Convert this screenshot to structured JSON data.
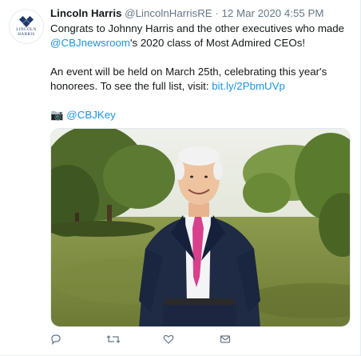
{
  "tweet": {
    "author_name": "Lincoln Harris",
    "author_handle": "@LincolnHarrisRE",
    "separator": "·",
    "timestamp": "12 Mar 2020 4:55 PM",
    "avatar_text_line1": "LINCOLN",
    "avatar_text_line2": "HARRIS",
    "paragraph1_part1": "Congrats to Johnny Harris and the other executives who made ",
    "mention_cbjnewsroom": "@CBJnewsroom",
    "paragraph1_part2": "'s 2020 class of Most Admired CEOs!",
    "paragraph2_part1": "An event will be held on March 25th, celebrating this year's honorees. To see the full list, visit: ",
    "link_url_text": "bit.ly/2PbmUVp",
    "camera_emoji": "📷",
    "mention_cbjkey": "@CBJKey"
  },
  "icons": {
    "reply": "reply-icon",
    "retweet": "retweet-icon",
    "like": "heart-icon",
    "dm": "envelope-icon"
  },
  "colors": {
    "link": "#1b95e0",
    "secondary_text": "#657786",
    "primary_text": "#14171a",
    "logo_blue": "#1f3a6b"
  }
}
